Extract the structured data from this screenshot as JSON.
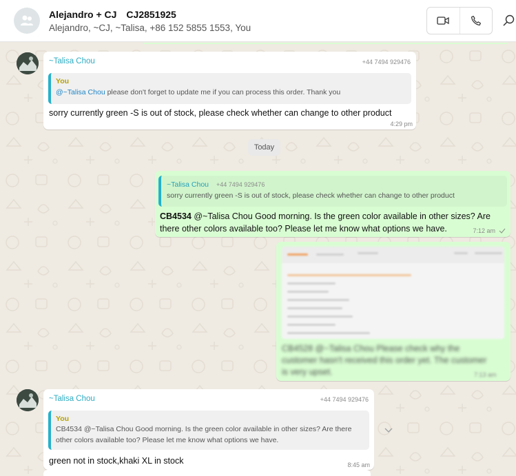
{
  "header": {
    "chat_title": "Alejandro + CJ",
    "chat_code": "CJ2851925",
    "participants": "Alejandro, ~CJ, ~Talisa, +86 152 5855 1553, You"
  },
  "messages": [
    {
      "sender": "~Talisa Chou",
      "phone": "+44 7494 929476",
      "quote_author": "You",
      "quote_mention": "@~Talisa Chou",
      "quote_text": " please don't forget to update me if you can process this order. Thank you",
      "text": "sorry currently green -S is out of stock, please check whether can change to other product",
      "time": "4:29 pm"
    },
    {
      "quote_author": "~Talisa Chou",
      "quote_phone": "+44 7494 929476",
      "quote_text": "sorry currently green -S is out of stock, please check whether can change to other product",
      "text_bold": "CB4534",
      "text": " @~Talisa Chou Good morning. Is the green color available in other sizes? Are there other colors available too? Please let me know what options we have.",
      "time": "7:12 am",
      "status_icon": "single-check"
    },
    {
      "blurred_caption": "CB4528 @~Talisa Chou Please check why the customer hasn't received this order yet. The customer is very upset.",
      "time": "7:13 am"
    },
    {
      "sender": "~Talisa Chou",
      "phone": "+44 7494 929476",
      "quote_author": "You",
      "quote_text": "CB4534 @~Talisa Chou Good morning. Is the green color available in other sizes? Are there other colors available too? Please let me know what options we have.",
      "text": "green not in stock,khaki XL in stock",
      "time": "8:45 am"
    }
  ],
  "date_divider": "Today",
  "colors": {
    "wallpaper": "#efeae2",
    "outgoing_bubble": "#d9fdd3",
    "sender_name": "#2dacc3",
    "mention": "#1f86c6",
    "quote_bar": "#26b1c9"
  },
  "icons": [
    "group-avatar-icon",
    "video-call-icon",
    "voice-call-icon",
    "search-icon",
    "chevron-down-icon",
    "check-icon"
  ]
}
